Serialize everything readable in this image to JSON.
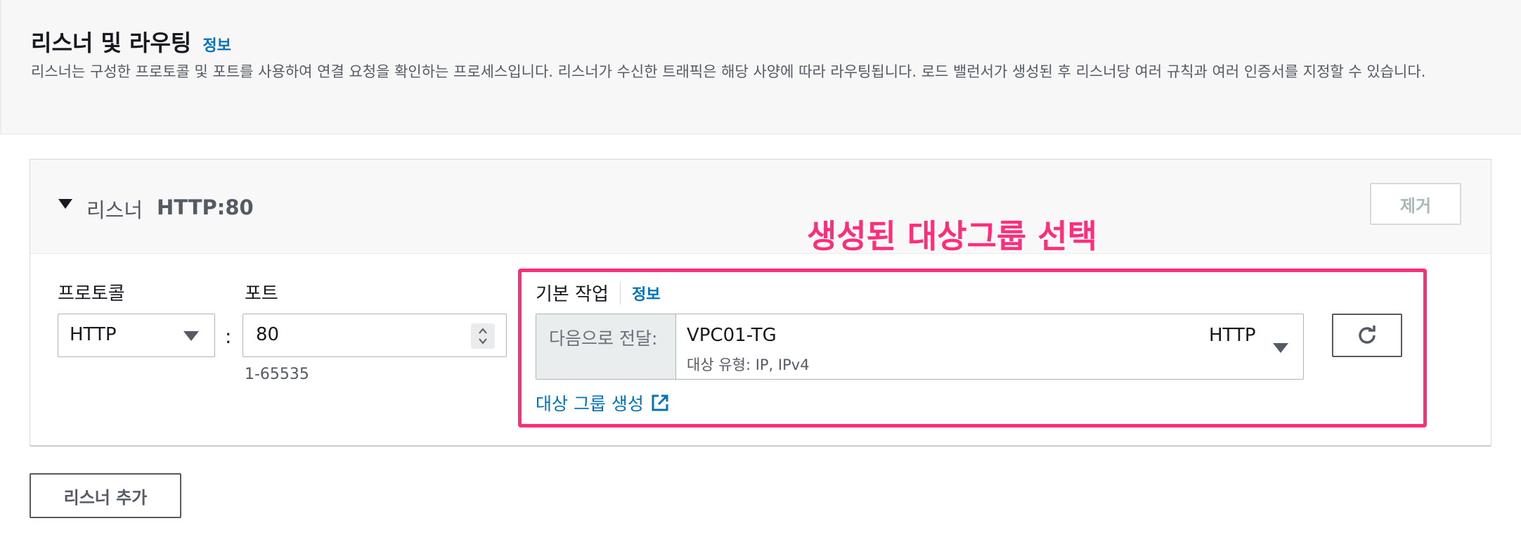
{
  "header": {
    "title": "리스너 및 라우팅",
    "info_link": "정보",
    "description": "리스너는 구성한 프로토콜 및 포트를 사용하여 연결 요청을 확인하는 프로세스입니다. 리스너가 수신한 트래픽은 해당 사양에 따라 라우팅됩니다. 로드 밸런서가 생성된 후 리스너당 여러 규칙과 여러 인증서를 지정할 수 있습니다."
  },
  "listener": {
    "label": "리스너",
    "protocol_port": "HTTP:80",
    "remove_label": "제거",
    "protocol_label": "프로토콜",
    "protocol_value": "HTTP",
    "colon": ":",
    "port_label": "포트",
    "port_value": "80",
    "port_hint": "1-65535",
    "default_action": {
      "label": "기본 작업",
      "info_link": "정보",
      "forward_prefix": "다음으로 전달:",
      "target_group_name": "VPC01-TG",
      "target_group_detail": "대상 유형: IP, IPv4",
      "target_group_protocol": "HTTP",
      "create_target_group_link": "대상 그룹 생성"
    }
  },
  "annotation": {
    "text": "생성된 대상그룹 선택",
    "color": "#ff2d7a"
  },
  "add_listener_label": "리스너 추가",
  "icons": {
    "expand": "caret-down-icon",
    "select": "chevron-down-icon",
    "external": "external-link-icon",
    "refresh": "refresh-icon"
  },
  "colors": {
    "link": "#0073bb",
    "highlight": "#ff2d7a"
  }
}
